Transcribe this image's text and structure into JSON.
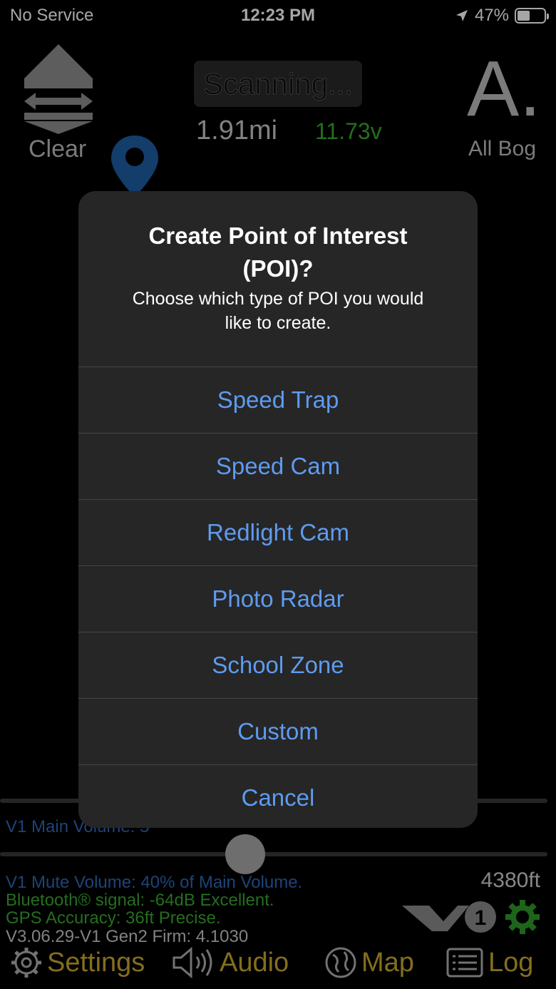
{
  "status_bar": {
    "carrier": "No Service",
    "time": "12:23 PM",
    "battery": "47%",
    "battery_level": 0.47
  },
  "header": {
    "clear_label": "Clear",
    "scan_status": "Scanning...",
    "distance": "1.91mi",
    "voltage": "11.73v",
    "mode_letter": "A.",
    "mode_label": "All Bog"
  },
  "dialog": {
    "title_line1": "Create Point of Interest",
    "title_line2": "(POI)?",
    "message_line1": "Choose which type of POI you would",
    "message_line2": "like to create.",
    "actions": [
      {
        "label": "Speed Trap"
      },
      {
        "label": "Speed Cam"
      },
      {
        "label": "Redlight Cam"
      },
      {
        "label": "Photo Radar"
      },
      {
        "label": "School Zone"
      },
      {
        "label": "Custom"
      },
      {
        "label": "Cancel"
      }
    ]
  },
  "footer": {
    "main_volume": "V1 Main Volume: 5",
    "mute_volume": "V1 Mute Volume: 40% of Main Volume.",
    "bluetooth": "Bluetooth® signal: -64dB Excellent.",
    "gps": "GPS Accuracy: 36ft Precise.",
    "version": "V3.06.29-V1 Gen2 Firm: 4.1030",
    "altitude": "4380ft",
    "logo_text": "1"
  },
  "nav": {
    "settings": "Settings",
    "audio": "Audio",
    "map": "Map",
    "log": "Log"
  },
  "colors": {
    "accent_blue": "#5e9bf0",
    "green": "#3aaa2e",
    "gold": "#c9a92f",
    "info_blue": "#2e68b8"
  }
}
